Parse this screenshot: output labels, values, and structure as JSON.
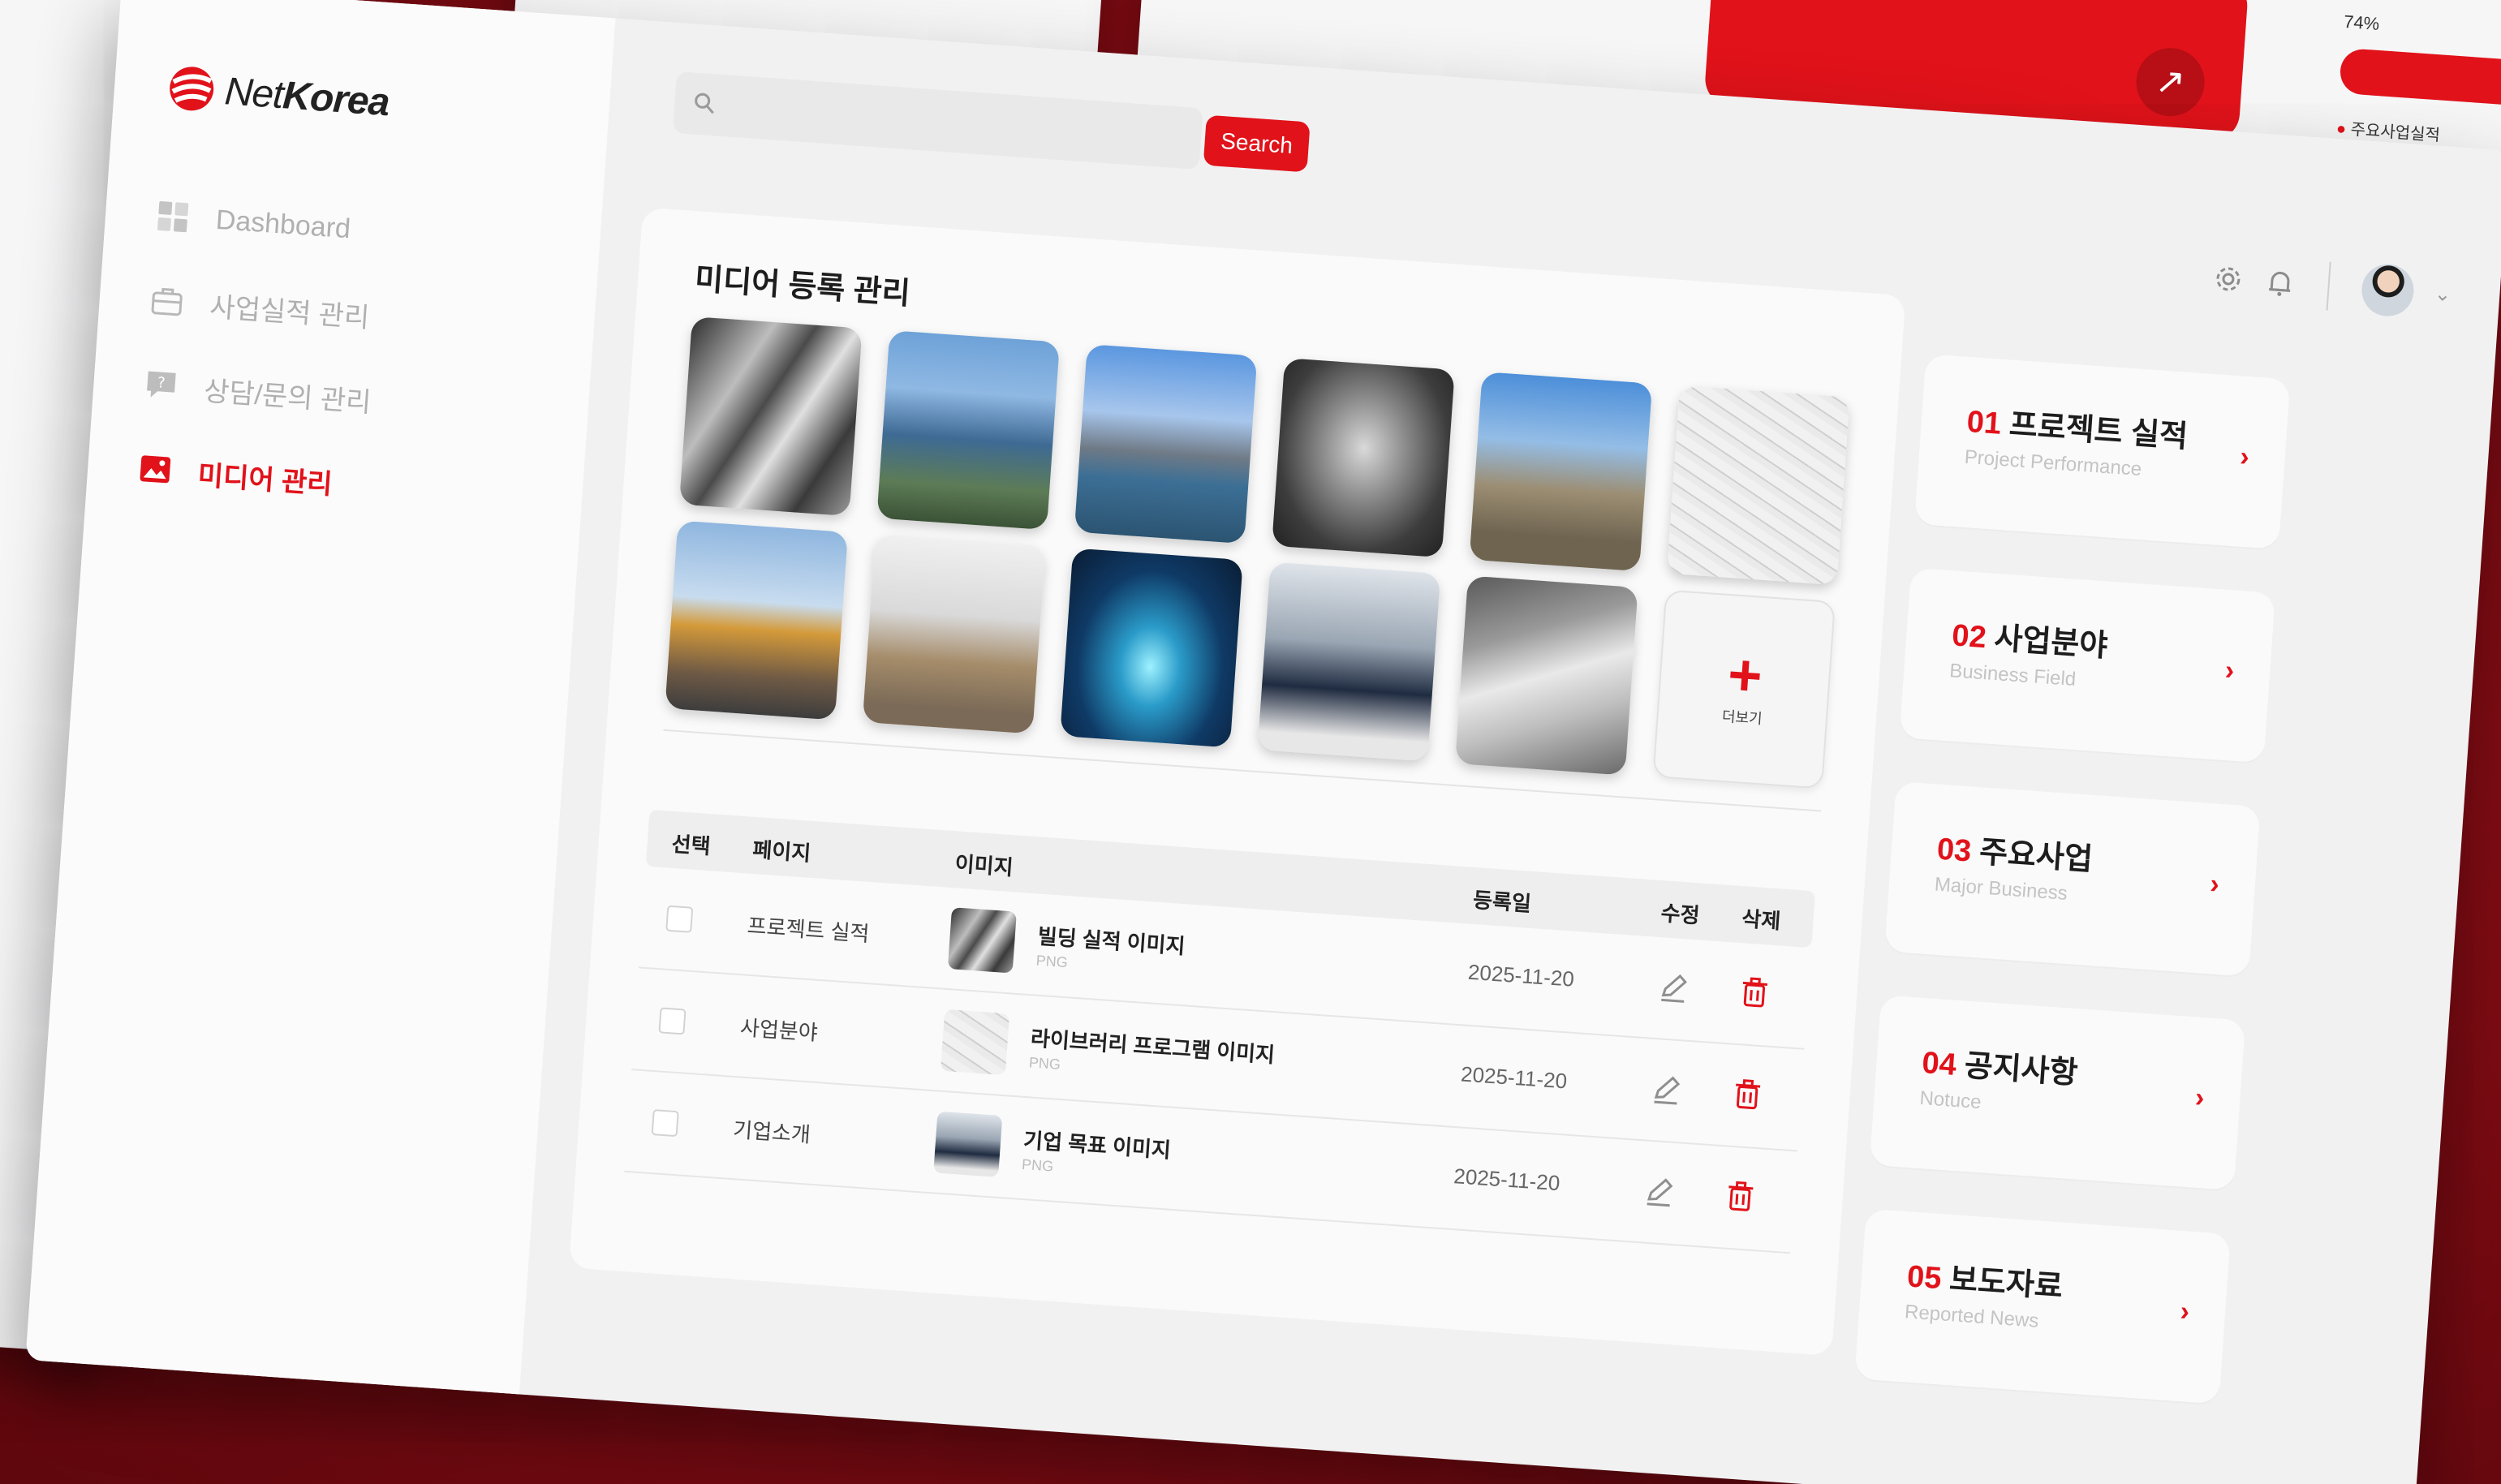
{
  "background": {
    "percent_label": "74%",
    "legend_label": "주요사업실적"
  },
  "app": {
    "logo_net": "Net",
    "logo_korea": "Korea"
  },
  "sidebar": {
    "items": [
      {
        "label": "Dashboard",
        "icon": "dashboard-grid-icon"
      },
      {
        "label": "사업실적 관리",
        "icon": "briefcase-icon"
      },
      {
        "label": "상담/문의 관리",
        "icon": "chat-question-icon"
      },
      {
        "label": "미디어 관리",
        "icon": "image-icon",
        "active": true
      }
    ]
  },
  "search": {
    "placeholder": "",
    "button": "Search"
  },
  "content": {
    "title": "미디어 등록 관리",
    "more_label": "더보기",
    "table": {
      "headers": {
        "select": "선택",
        "page": "페이지",
        "image": "이미지",
        "date": "등록일",
        "edit": "수정",
        "delete": "삭제"
      },
      "rows": [
        {
          "page": "프로젝트 실적",
          "image_name": "빌딩 실적 이미지",
          "type": "PNG",
          "date": "2025-11-20"
        },
        {
          "page": "사업분야",
          "image_name": "라이브러리 프로그램 이미지",
          "type": "PNG",
          "date": "2025-11-20"
        },
        {
          "page": "기업소개",
          "image_name": "기업 목표 이미지",
          "type": "PNG",
          "date": "2025-11-20"
        }
      ]
    }
  },
  "quicklinks": [
    {
      "num": "01",
      "title": "프로젝트 실적",
      "subtitle": "Project Performance"
    },
    {
      "num": "02",
      "title": "사업분야",
      "subtitle": "Business Field"
    },
    {
      "num": "03",
      "title": "주요사업",
      "subtitle": "Major Business"
    },
    {
      "num": "04",
      "title": "공지사항",
      "subtitle": "Notuce"
    },
    {
      "num": "05",
      "title": "보도자료",
      "subtitle": "Reported News"
    }
  ],
  "colors": {
    "accent": "#e1121a",
    "bg_dark": "#8f0d16"
  }
}
